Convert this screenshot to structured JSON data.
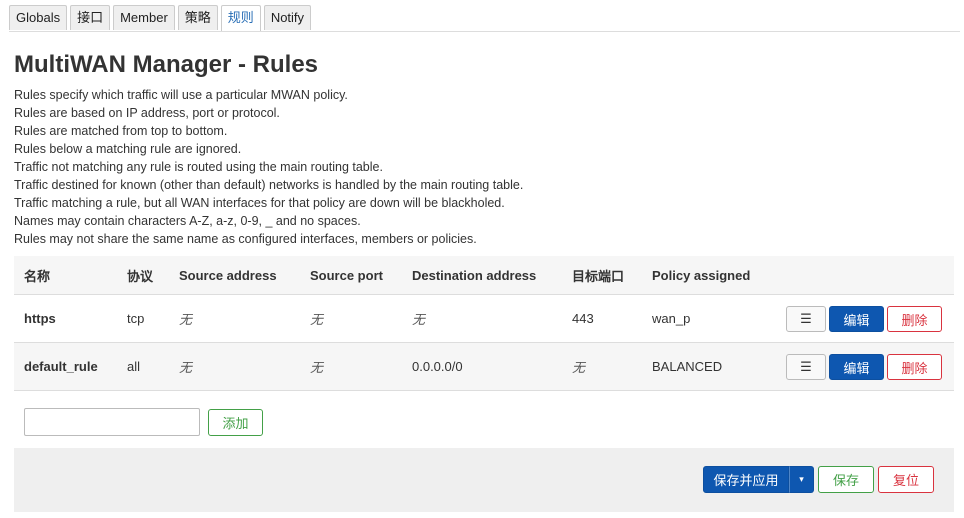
{
  "tabs": [
    {
      "label": "Globals",
      "active": false
    },
    {
      "label": "接口",
      "active": false
    },
    {
      "label": "Member",
      "active": false
    },
    {
      "label": "策略",
      "active": false
    },
    {
      "label": "规则",
      "active": true
    },
    {
      "label": "Notify",
      "active": false
    }
  ],
  "page_title": "MultiWAN Manager - Rules",
  "description": [
    "Rules specify which traffic will use a particular MWAN policy.",
    "Rules are based on IP address, port or protocol.",
    "Rules are matched from top to bottom.",
    "Rules below a matching rule are ignored.",
    "Traffic not matching any rule is routed using the main routing table.",
    "Traffic destined for known (other than default) networks is handled by the main routing table.",
    "Traffic matching a rule, but all WAN interfaces for that policy are down will be blackholed.",
    "Names may contain characters A-Z, a-z, 0-9, _ and no spaces.",
    "Rules may not share the same name as configured interfaces, members or policies."
  ],
  "table": {
    "headers": [
      "名称",
      "协议",
      "Source address",
      "Source port",
      "Destination address",
      "目标端口",
      "Policy assigned"
    ],
    "rows": [
      {
        "name": "https",
        "proto": "tcp",
        "src_ip": "无",
        "src_port": "无",
        "dest_ip": "无",
        "dest_port": "443",
        "policy": "wan_p"
      },
      {
        "name": "default_rule",
        "proto": "all",
        "src_ip": "无",
        "src_port": "无",
        "dest_ip": "0.0.0.0/0",
        "dest_port": "无",
        "policy": "BALANCED"
      }
    ],
    "sort_label": "☰",
    "edit_label": "编辑",
    "delete_label": "删除"
  },
  "add": {
    "input_value": "",
    "button_label": "添加"
  },
  "footer": {
    "save_apply_label": "保存并应用",
    "caret": "▾",
    "save_label": "保存",
    "reset_label": "复位"
  },
  "colors": {
    "primary": "#0e57b0",
    "positive": "#43a047",
    "negative": "#d9333f",
    "active_tab": "#2a6fb6"
  }
}
